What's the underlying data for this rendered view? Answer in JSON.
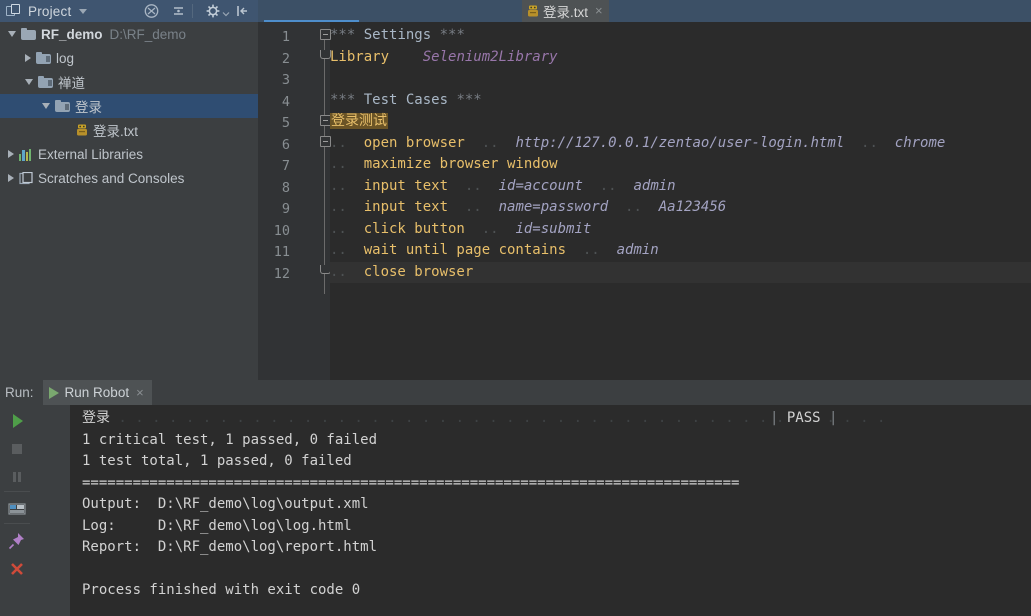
{
  "window": {
    "toolbar": {
      "project_label": "Project",
      "icons": [
        "project-icon",
        "caret-down-icon",
        "collapse-all-icon",
        "separator-icon",
        "settings-gear-icon",
        "hide-panel-icon"
      ]
    }
  },
  "tabs": [
    {
      "label": "登录.txt",
      "icon": "robot-file-icon",
      "active": true,
      "close": "×"
    }
  ],
  "sidebar": {
    "items": [
      {
        "label": "RF_demo",
        "path": "D:\\RF_demo",
        "arrow": "down",
        "icon": "folder-icon",
        "depth": 0,
        "bold": true,
        "selected": false
      },
      {
        "label": "log",
        "path": "",
        "arrow": "right",
        "icon": "folder-icon",
        "depth": 1,
        "bold": false,
        "selected": false
      },
      {
        "label": "禅道",
        "path": "",
        "arrow": "down",
        "icon": "folder-icon",
        "depth": 1,
        "bold": false,
        "selected": false
      },
      {
        "label": "登录",
        "path": "",
        "arrow": "down",
        "icon": "folder-icon",
        "depth": 2,
        "bold": false,
        "selected": true
      },
      {
        "label": "登录.txt",
        "path": "",
        "arrow": "none",
        "icon": "robot-file-icon",
        "depth": 3,
        "bold": false,
        "selected": false
      },
      {
        "label": "External Libraries",
        "path": "",
        "arrow": "right",
        "icon": "libraries-icon",
        "depth": 0,
        "bold": false,
        "selected": false
      },
      {
        "label": "Scratches and Consoles",
        "path": "",
        "arrow": "right",
        "icon": "scratches-icon",
        "depth": 0,
        "bold": false,
        "selected": false
      }
    ]
  },
  "editor": {
    "line_numbers": [
      "1",
      "2",
      "3",
      "4",
      "5",
      "6",
      "7",
      "8",
      "9",
      "10",
      "11",
      "12"
    ],
    "current_line": 12,
    "lines": [
      {
        "n": 1,
        "tokens": [
          {
            "t": "***",
            "c": "secstar"
          },
          {
            "t": " Settings ",
            "c": "sec"
          },
          {
            "t": "***",
            "c": "secstar"
          }
        ]
      },
      {
        "n": 2,
        "tokens": [
          {
            "t": "Library",
            "c": "kw"
          },
          {
            "t": "    ",
            "c": "plain"
          },
          {
            "t": "Selenium2Library",
            "c": "arg"
          }
        ]
      },
      {
        "n": 3,
        "tokens": []
      },
      {
        "n": 4,
        "tokens": [
          {
            "t": "***",
            "c": "secstar"
          },
          {
            "t": " Test Cases ",
            "c": "sec"
          },
          {
            "t": "***",
            "c": "secstar"
          }
        ]
      },
      {
        "n": 5,
        "tokens": [
          {
            "t": "登录测试",
            "c": "tcname"
          }
        ]
      },
      {
        "n": 6,
        "tokens": [
          {
            "t": "..",
            "c": "dots"
          },
          {
            "t": "  ",
            "c": "plain"
          },
          {
            "t": "open browser",
            "c": "kw"
          },
          {
            "t": "  ..  ",
            "c": "dots"
          },
          {
            "t": "http://127.0.0.1/zentao/user-login.html",
            "c": "argl"
          },
          {
            "t": "  ..  ",
            "c": "dots"
          },
          {
            "t": "chrome",
            "c": "argl"
          }
        ]
      },
      {
        "n": 7,
        "tokens": [
          {
            "t": "..",
            "c": "dots"
          },
          {
            "t": "  ",
            "c": "plain"
          },
          {
            "t": "maximize browser window",
            "c": "kw"
          }
        ]
      },
      {
        "n": 8,
        "tokens": [
          {
            "t": "..",
            "c": "dots"
          },
          {
            "t": "  ",
            "c": "plain"
          },
          {
            "t": "input text",
            "c": "kw"
          },
          {
            "t": "  ..  ",
            "c": "dots"
          },
          {
            "t": "id=account",
            "c": "argl"
          },
          {
            "t": "  ..  ",
            "c": "dots"
          },
          {
            "t": "admin",
            "c": "argl"
          }
        ]
      },
      {
        "n": 9,
        "tokens": [
          {
            "t": "..",
            "c": "dots"
          },
          {
            "t": "  ",
            "c": "plain"
          },
          {
            "t": "input text",
            "c": "kw"
          },
          {
            "t": "  ..  ",
            "c": "dots"
          },
          {
            "t": "name=password",
            "c": "argl"
          },
          {
            "t": "  ..  ",
            "c": "dots"
          },
          {
            "t": "Aa123456",
            "c": "argl"
          }
        ]
      },
      {
        "n": 10,
        "tokens": [
          {
            "t": "..",
            "c": "dots"
          },
          {
            "t": "  ",
            "c": "plain"
          },
          {
            "t": "click button",
            "c": "kw"
          },
          {
            "t": "  ..  ",
            "c": "dots"
          },
          {
            "t": "id=submit",
            "c": "argl"
          }
        ]
      },
      {
        "n": 11,
        "tokens": [
          {
            "t": "..",
            "c": "dots"
          },
          {
            "t": "  ",
            "c": "plain"
          },
          {
            "t": "wait until page contains",
            "c": "kw"
          },
          {
            "t": "  ..  ",
            "c": "dots"
          },
          {
            "t": "admin",
            "c": "argl"
          }
        ]
      },
      {
        "n": 12,
        "tokens": [
          {
            "t": "..",
            "c": "dots"
          },
          {
            "t": "  ",
            "c": "plain"
          },
          {
            "t": "close browser",
            "c": "kw"
          }
        ]
      }
    ]
  },
  "run_panel": {
    "label": "Run:",
    "tab": {
      "label": "Run Robot",
      "icon": "play-icon",
      "close": "×"
    },
    "left_toolbar": [
      {
        "name": "rerun-icon"
      },
      {
        "name": "stop-icon"
      },
      {
        "name": "pause-icon"
      },
      {
        "name": "toggle-console-icon"
      },
      {
        "name": "pin-tab-icon"
      },
      {
        "name": "close-icon"
      }
    ],
    "right_toolbar": [
      {
        "name": "scroll-up-icon"
      },
      {
        "name": "scroll-down-icon"
      },
      {
        "name": "soft-wrap-icon"
      },
      {
        "name": "scroll-to-end-icon"
      },
      {
        "name": "print-icon"
      },
      {
        "name": "clear-all-icon"
      }
    ],
    "console": {
      "lines": [
        {
          "text": "登录",
          "dots_after": true,
          "pass": "PASS"
        },
        {
          "text": "1 critical test, 1 passed, 0 failed"
        },
        {
          "text": "1 test total, 1 passed, 0 failed"
        },
        {
          "text": "=============================================================================="
        },
        {
          "text": "Output:  D:\\RF_demo\\log\\output.xml"
        },
        {
          "text": "Log:     D:\\RF_demo\\log\\log.html"
        },
        {
          "text": "Report:  D:\\RF_demo\\log\\report.html"
        },
        {
          "text": ""
        },
        {
          "text": "Process finished with exit code 0"
        }
      ],
      "pass_bar_left": "|",
      "pass_bar_right": "|"
    }
  },
  "colors": {
    "editor_bg": "#2b2b2b",
    "panel_bg": "#3c3f41",
    "titlebar_bg": "#3c5066",
    "selection_bg": "#2f4d72",
    "keyword": "#e8bf6a",
    "argument": "#a3a3c2",
    "testcase_highlight_bg": "#6b5426",
    "accent_blue": "#4e8ecc",
    "pass_green": "#7aa86f"
  }
}
